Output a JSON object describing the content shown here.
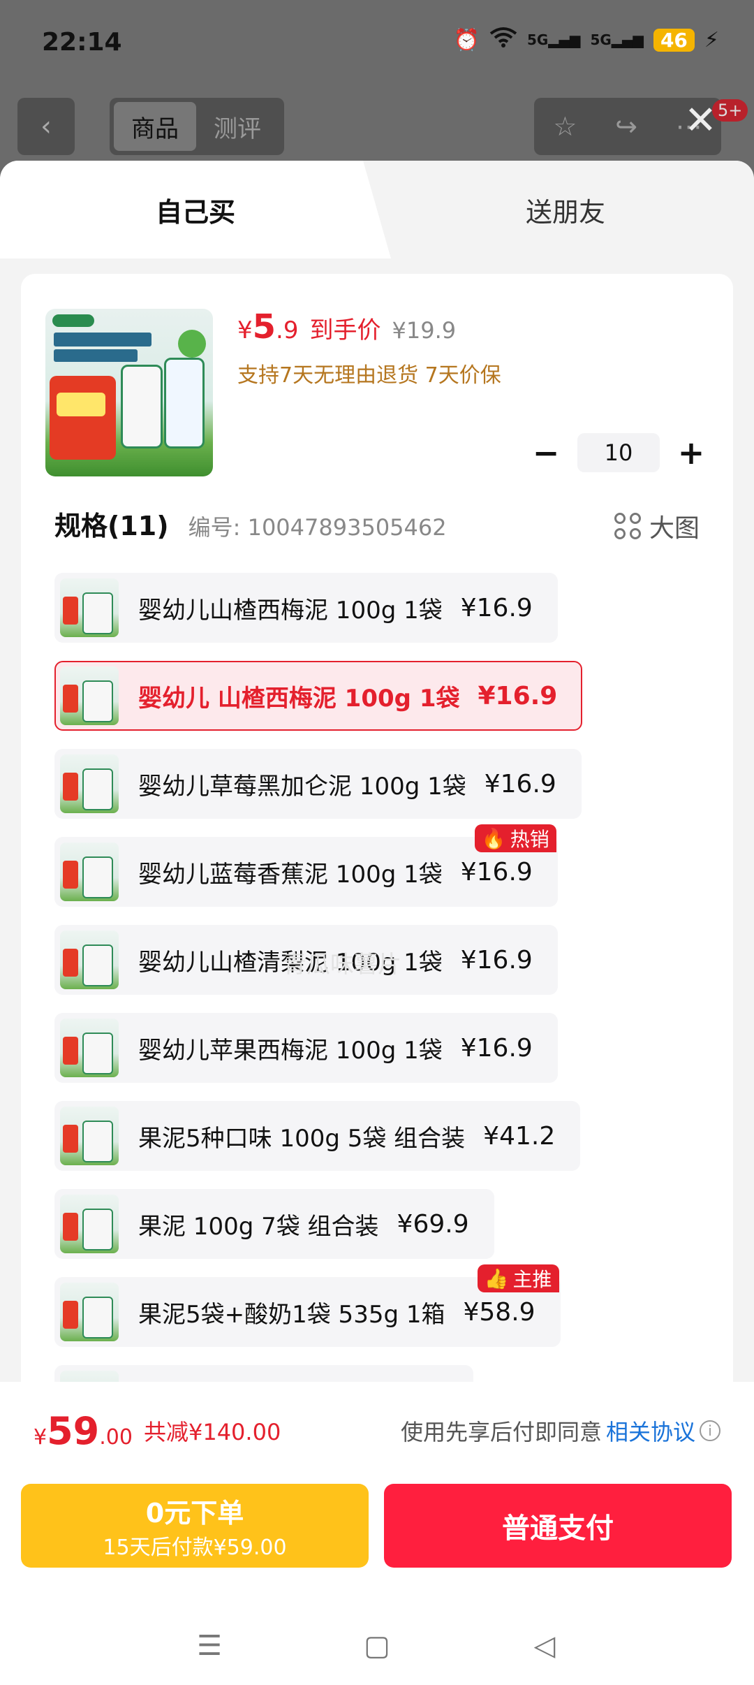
{
  "status": {
    "time": "22:14",
    "network1": "5G",
    "network2": "5G",
    "battery": "46"
  },
  "topbar": {
    "back_icon": "chevron-left-icon",
    "tabs": [
      {
        "label": "商品",
        "active": true
      },
      {
        "label": "测评",
        "active": false
      }
    ],
    "actions": [
      "star-icon",
      "share-icon",
      "more-icon"
    ],
    "close_icon": "close-icon",
    "badge": "5+"
  },
  "sheet": {
    "tab_self": "自己买",
    "tab_gift": "送朋友"
  },
  "product": {
    "price_symbol": "¥",
    "price_int": "5",
    "price_dec": ".9",
    "price_label": "到手价",
    "orig_price": "¥19.9",
    "policy": "支持7天无理由退货 7天价保",
    "quantity": "10"
  },
  "spec": {
    "title": "规格(11)",
    "code": "编号: 10047893505462",
    "bigimg_label": "大图",
    "items": [
      {
        "name": "婴幼儿山楂西梅泥 100g 1袋",
        "price": "¥16.9",
        "selected": false,
        "tag": ""
      },
      {
        "name": "婴幼儿 山楂西梅泥 100g 1袋",
        "price": "¥16.9",
        "selected": true,
        "tag": ""
      },
      {
        "name": "婴幼儿草莓黑加仑泥 100g 1袋",
        "price": "¥16.9",
        "selected": false,
        "tag": ""
      },
      {
        "name": "婴幼儿蓝莓香蕉泥 100g 1袋",
        "price": "¥16.9",
        "selected": false,
        "tag": "热销"
      },
      {
        "name": "婴幼儿山楂清梨泥 100g 1袋",
        "price": "¥16.9",
        "selected": false,
        "tag": ""
      },
      {
        "name": "婴幼儿苹果西梅泥 100g 1袋",
        "price": "¥16.9",
        "selected": false,
        "tag": ""
      },
      {
        "name": "果泥5种口味 100g 5袋 组合装",
        "price": "¥41.2",
        "selected": false,
        "tag": ""
      },
      {
        "name": "果泥 100g 7袋 组合装",
        "price": "¥69.9",
        "selected": false,
        "tag": ""
      },
      {
        "name": "果泥5袋+酸奶1袋 535g 1箱",
        "price": "¥58.9",
        "selected": false,
        "tag": "主推"
      }
    ],
    "watermark": "青瓜味薯片"
  },
  "bottom": {
    "total_symbol": "¥",
    "total_int": "59",
    "total_dec": ".00",
    "discount": "共减¥140.00",
    "agree_prefix": "使用先享后付即同意",
    "agree_link": "相关协议",
    "bnpl_line1": "0元下单",
    "bnpl_line2": "15天后付款¥59.00",
    "pay_label": "普通支付"
  },
  "colors": {
    "accent": "#e4202d",
    "bnpl": "#ffc21a",
    "pay": "#ff1f3e",
    "link": "#1a73d9",
    "policy": "#b5761f"
  }
}
